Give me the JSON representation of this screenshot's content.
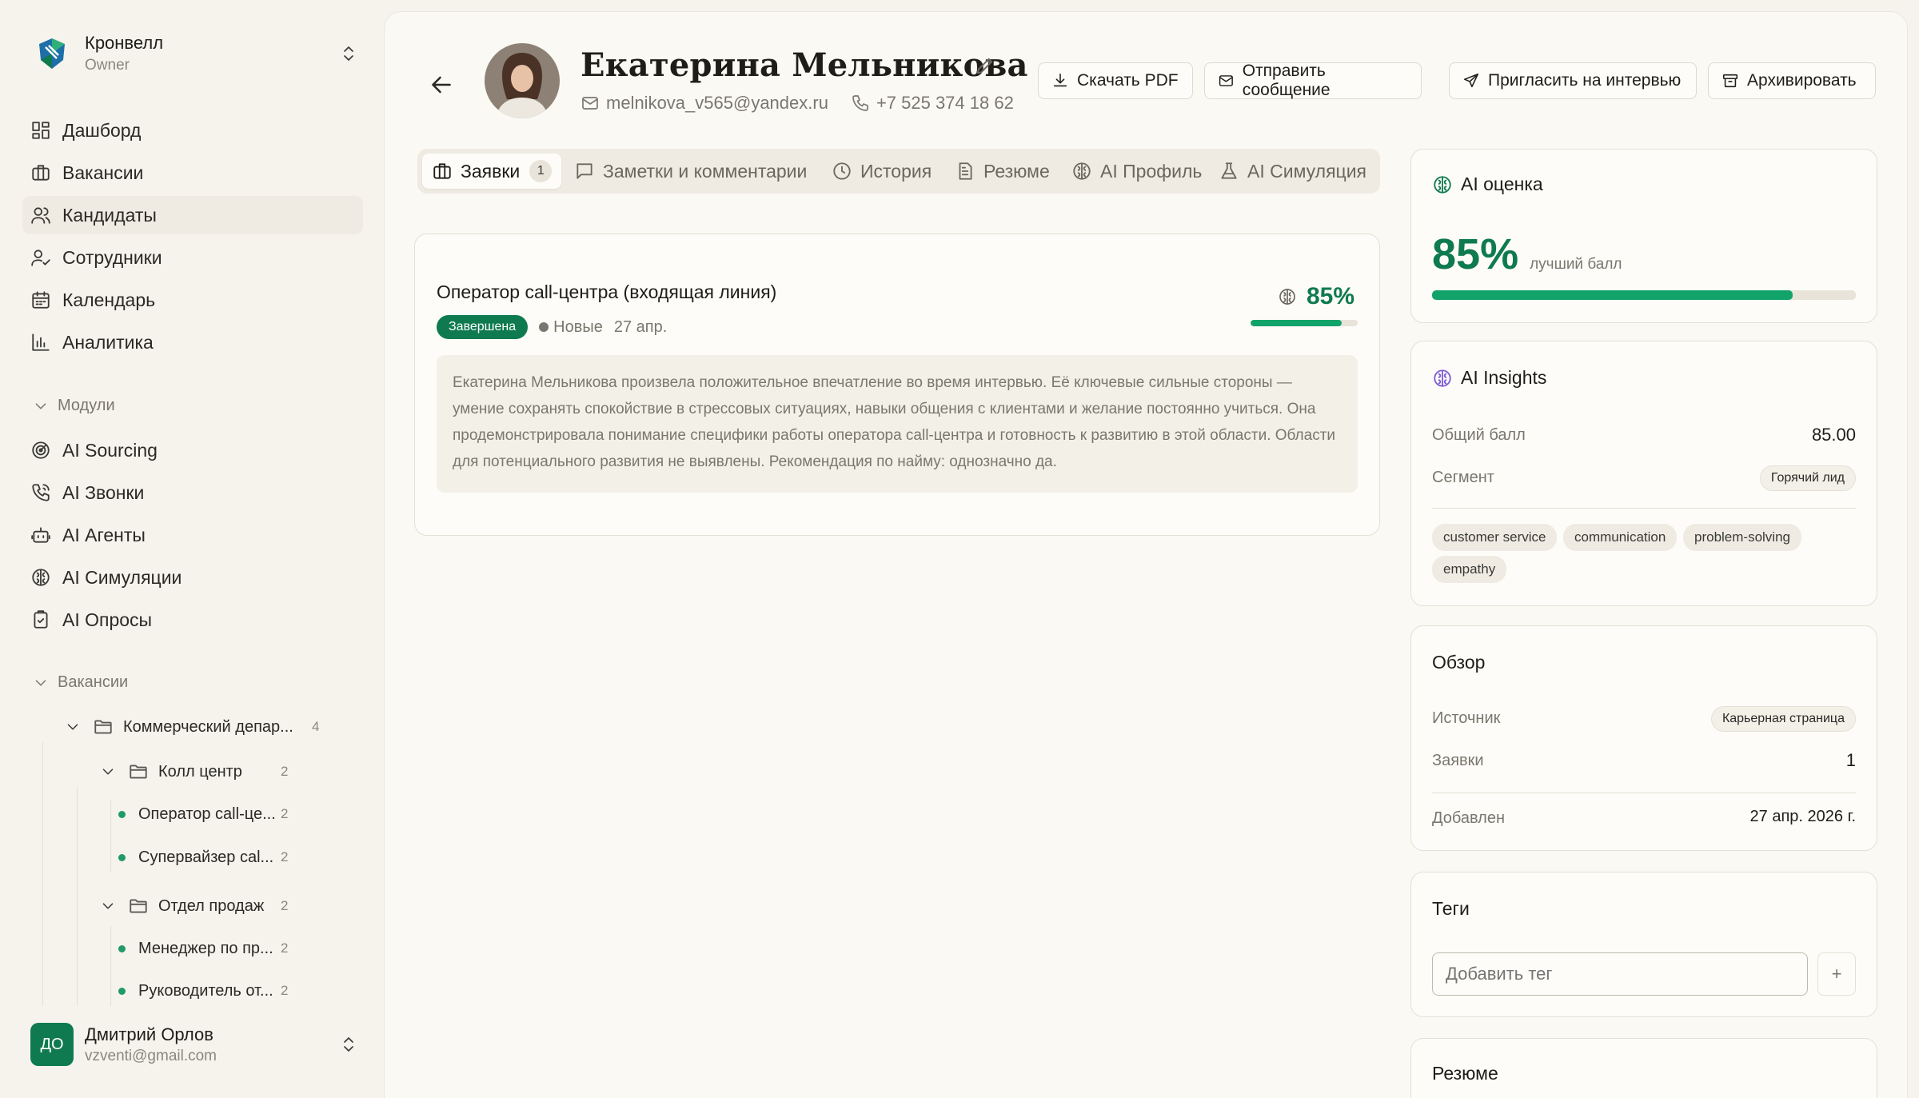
{
  "org": {
    "name": "Кронвелл",
    "role": "Owner"
  },
  "nav": [
    {
      "label": "Дашборд",
      "icon": "dashboard-icon"
    },
    {
      "label": "Вакансии",
      "icon": "briefcase-icon"
    },
    {
      "label": "Кандидаты",
      "icon": "users-icon",
      "active": true
    },
    {
      "label": "Сотрудники",
      "icon": "user-check-icon"
    },
    {
      "label": "Календарь",
      "icon": "calendar-icon"
    },
    {
      "label": "Аналитика",
      "icon": "chart-icon"
    }
  ],
  "modules": {
    "label": "Модули",
    "items": [
      {
        "label": "AI Sourcing",
        "icon": "radar-icon"
      },
      {
        "label": "AI Звонки",
        "icon": "phone-call-icon"
      },
      {
        "label": "AI Агенты",
        "icon": "bot-icon"
      },
      {
        "label": "AI Симуляции",
        "icon": "brain-icon"
      },
      {
        "label": "AI Опросы",
        "icon": "clipboard-icon"
      }
    ]
  },
  "vacancies": {
    "label": "Вакансии",
    "tree": {
      "commercial": {
        "label": "Коммерческий депар...",
        "count": "4"
      },
      "callcenter": {
        "label": "Колл центр",
        "count": "2"
      },
      "operator": {
        "label": "Оператор call-це...",
        "count": "2"
      },
      "supervisor": {
        "label": "Супервайзер cal...",
        "count": "2"
      },
      "sales": {
        "label": "Отдел продаж",
        "count": "2"
      },
      "manager": {
        "label": "Менеджер по пр...",
        "count": "2"
      },
      "head": {
        "label": "Руководитель от...",
        "count": "2"
      }
    }
  },
  "user": {
    "initials": "ДО",
    "name": "Дмитрий Орлов",
    "email": "vzventi@gmail.com"
  },
  "candidate": {
    "name": "Екатерина Мельникова",
    "email": "melnikova_v565@yandex.ru",
    "phone": "+7 525 374 18 62"
  },
  "actions": {
    "pdf": "Скачать PDF",
    "message": "Отправить сообщение",
    "invite": "Пригласить на интервью",
    "archive": "Архивировать"
  },
  "tabs": {
    "applications": "Заявки",
    "applications_count": "1",
    "notes": "Заметки и комментарии",
    "history": "История",
    "resume": "Резюме",
    "ai_profile": "AI Профиль",
    "ai_simulation": "AI Симуляция"
  },
  "application": {
    "title": "Оператор call-центра (входящая линия)",
    "status": "Завершена",
    "stage": "Новые",
    "date": "27 апр.",
    "score_text": "85%",
    "score_value": 0.85,
    "summary": "Екатерина Мельникова произвела положительное впечатление во время интервью. Её ключевые сильные стороны — умение сохранять спокойствие в стрессовых ситуациях, навыки общения с клиентами и желание постоянно учиться. Она продемонстрировала понимание специфики работы оператора call-центра и готовность к развитию в этой области. Области для потенциального развития не выявлены. Рекомендация по найму: однозначно да."
  },
  "ai_score": {
    "title": "AI оценка",
    "value_text": "85%",
    "value": 0.85,
    "caption": "лучший балл"
  },
  "ai_insights": {
    "title": "AI Insights",
    "total_label": "Общий балл",
    "total_value": "85.00",
    "segment_label": "Сегмент",
    "segment_value": "Горячий лид",
    "skills": [
      "customer service",
      "communication",
      "problem-solving",
      "empathy"
    ]
  },
  "overview": {
    "title": "Обзор",
    "source_label": "Источник",
    "source_value": "Карьерная страница",
    "apps_label": "Заявки",
    "apps_value": "1",
    "added_label": "Добавлен",
    "added_value": "27 апр. 2026 г."
  },
  "tags": {
    "title": "Теги",
    "placeholder": "Добавить тег",
    "add": "+"
  },
  "resume_card": {
    "title": "Резюме"
  },
  "colors": {
    "accent": "#0f7a50",
    "bar": "#12a36b",
    "background": "#f6f3ec"
  }
}
